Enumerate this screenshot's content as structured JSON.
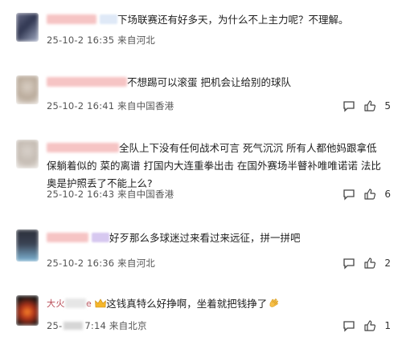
{
  "comments": [
    {
      "content": "下场联赛还有好多天，为什么不上主力呢？不理解。",
      "date": "25-10-2",
      "time": "16:35",
      "location": "来自河北",
      "likes": "2"
    },
    {
      "content": "不想踢可以滚蛋 把机会让给别的球队",
      "date": "25-10-2",
      "time": "16:41",
      "location": "来自中国香港",
      "likes": "5"
    },
    {
      "content": "全队上下没有任何战术可言 死气沉沉 所有人都他妈跟拿低保躺着似的 菜的离谱 打国内大连重拳出击 在国外赛场半瞽补唯唯诺诺 法比奥是护照丢了不能上么?",
      "date": "25-10-2",
      "time": "16:43",
      "location": "来自中国香港",
      "likes": "6"
    },
    {
      "content": "好歹那么多球迷过来看过来远征，拼一拼吧",
      "date": "25-10-2",
      "time": "16:36",
      "location": "来自河北",
      "likes": "2"
    },
    {
      "name_visible": "大火",
      "name_visible_end": "e",
      "content": "这钱真特么好挣啊，坐着就把钱挣了",
      "date_prefix": "25-",
      "time": "7:14",
      "location": "来自北京",
      "likes": "1"
    }
  ],
  "icons": {
    "reply": "reply-icon",
    "like": "thumbs-up-icon",
    "crown": "crown-icon",
    "clap": "clapping-hands-icon"
  }
}
